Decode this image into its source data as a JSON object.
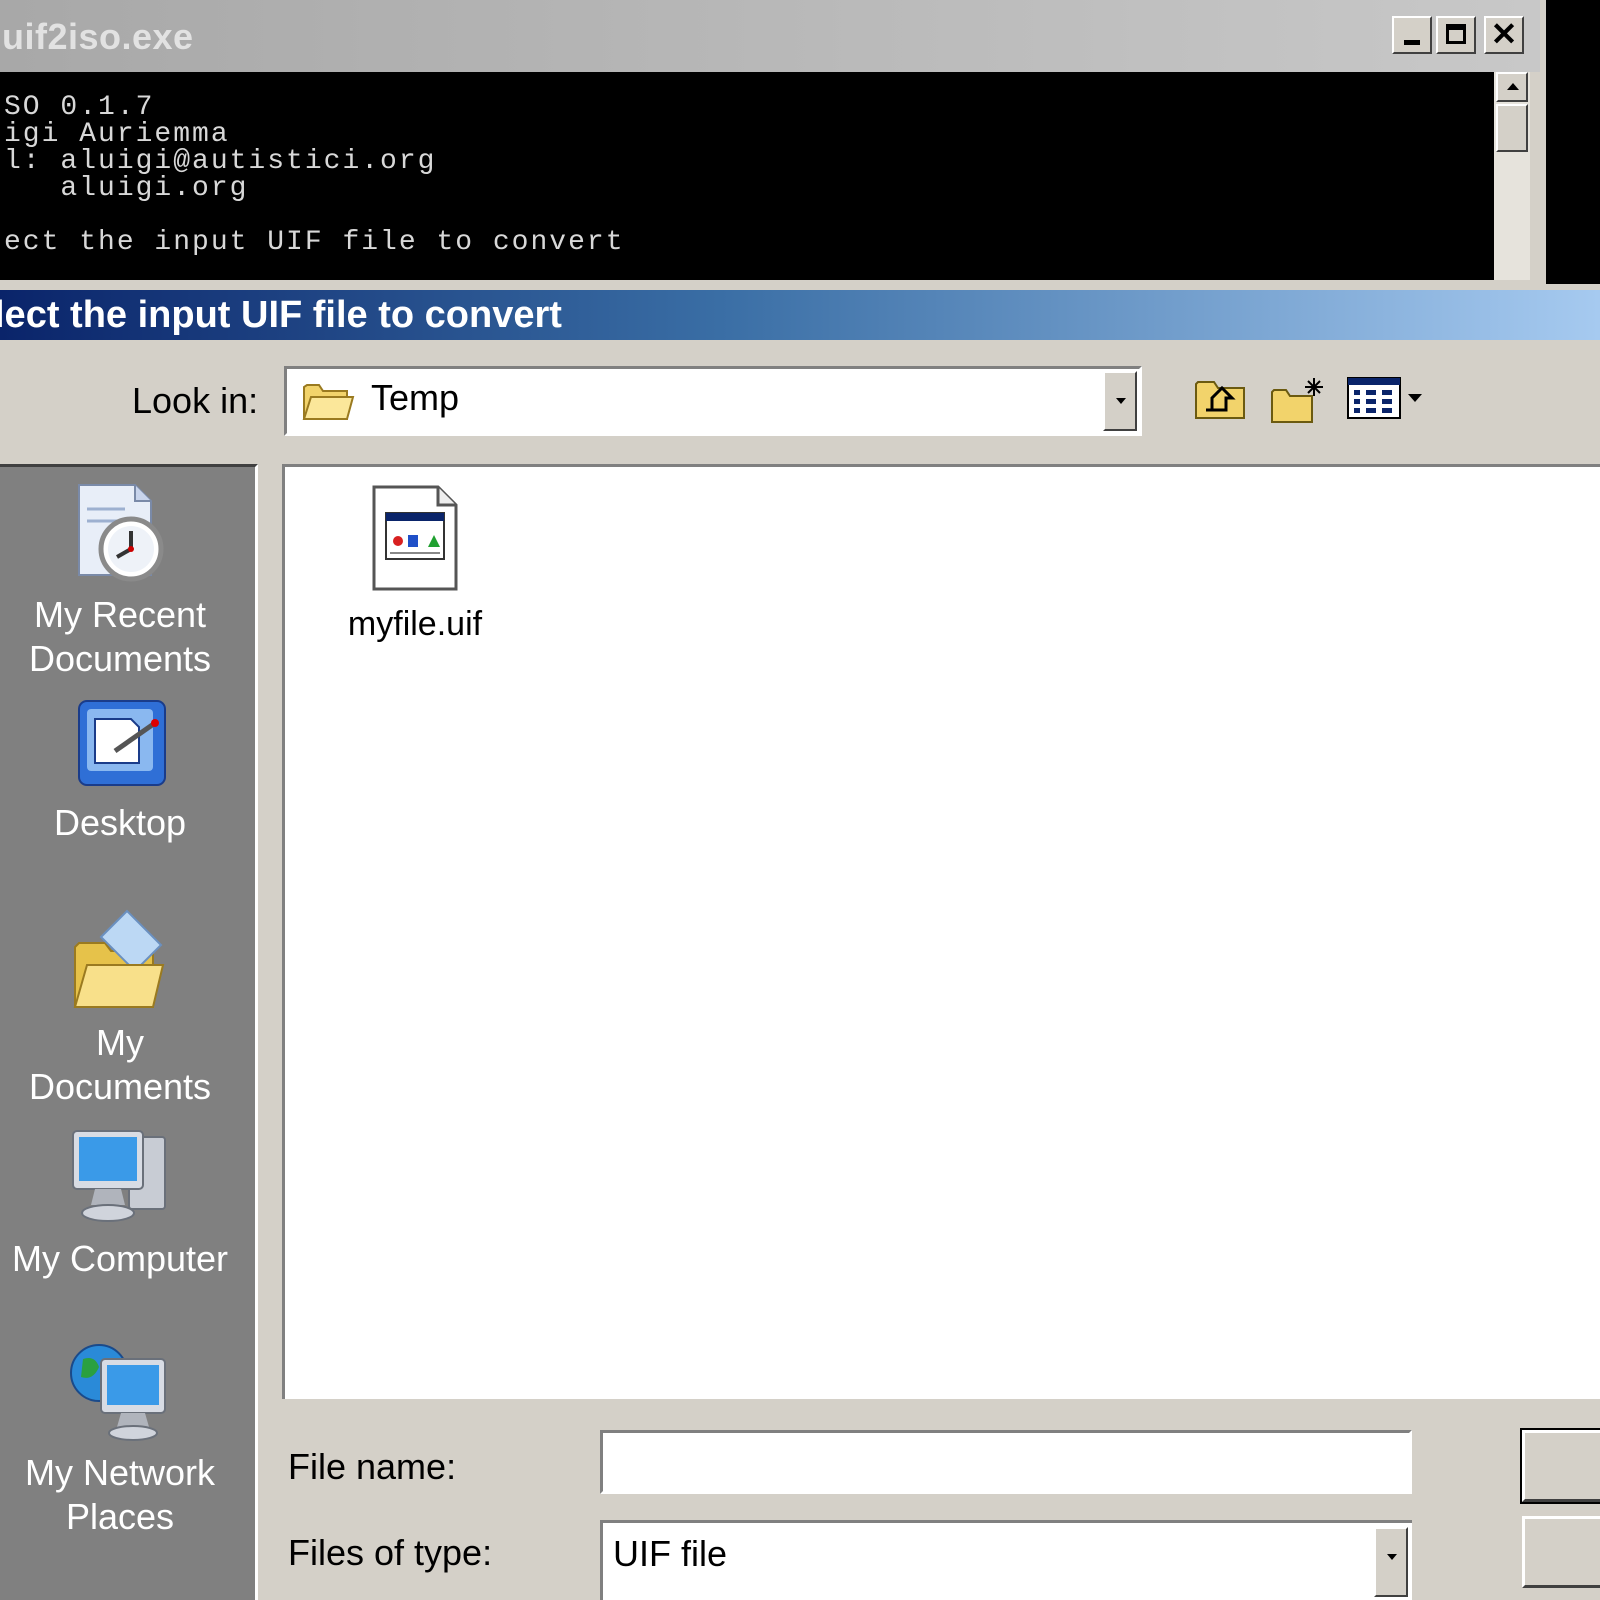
{
  "console": {
    "title": "uif2iso.exe",
    "lines": [
      "SO 0.1.7",
      "igi Auriemma",
      "l: aluigi@autistici.org",
      "   aluigi.org",
      "",
      "ect the input UIF file to convert"
    ],
    "buttons": {
      "minimize": "minimize-icon",
      "maximize": "maximize-icon",
      "close": "✕"
    }
  },
  "dialog": {
    "title": "lect the input UIF file to convert",
    "look_in_label": "Look in:",
    "look_in_value": "Temp",
    "toolbar_icons": [
      "up-one-level-icon",
      "create-new-folder-icon",
      "view-menu-icon"
    ],
    "places": [
      {
        "label_line1": "My Recent",
        "label_line2": "Documents",
        "icon": "recent-documents-icon"
      },
      {
        "label_line1": "Desktop",
        "label_line2": "",
        "icon": "desktop-icon"
      },
      {
        "label_line1": "My Documents",
        "label_line2": "",
        "icon": "my-documents-icon"
      },
      {
        "label_line1": "My Computer",
        "label_line2": "",
        "icon": "my-computer-icon"
      },
      {
        "label_line1": "My Network",
        "label_line2": "Places",
        "icon": "my-network-places-icon"
      }
    ],
    "files": [
      {
        "name": "myfile.uif",
        "icon": "uif-file-icon"
      }
    ],
    "file_name_label": "File name:",
    "file_name_value": "",
    "files_of_type_label": "Files of type:",
    "files_of_type_value": "UIF file"
  },
  "colors": {
    "dialog_title_start": "#0a246a",
    "dialog_title_end": "#a6caf0",
    "places_bar": "#808080",
    "console_bg": "#000000"
  }
}
